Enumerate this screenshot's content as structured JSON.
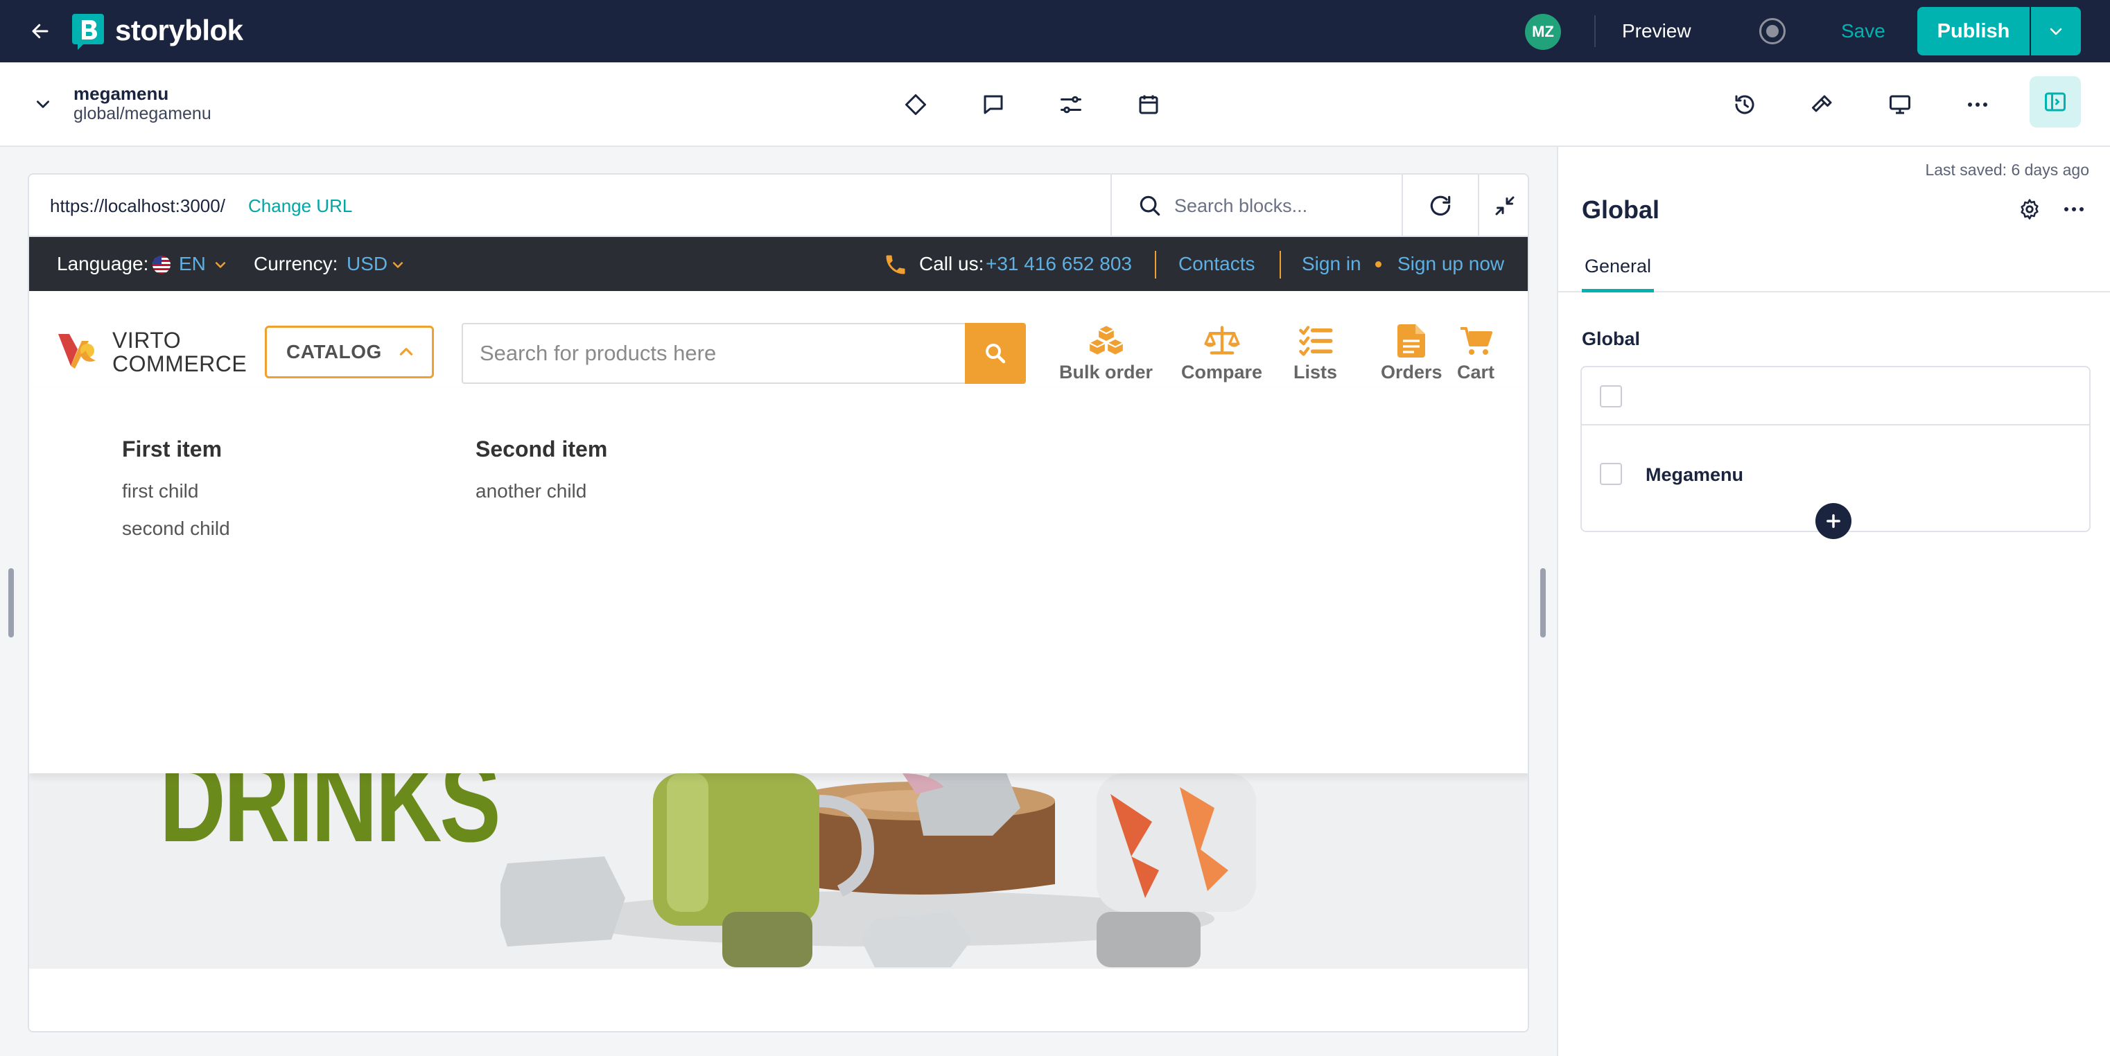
{
  "app": {
    "brand": "storyblok",
    "brand_color": "#00b3b0"
  },
  "topbar": {
    "avatar_initials": "MZ",
    "preview_label": "Preview",
    "save_label": "Save",
    "publish_label": "Publish"
  },
  "story": {
    "name": "megamenu",
    "path": "global/megamenu"
  },
  "preview": {
    "url": "https://localhost:3000/",
    "change_url_label": "Change URL",
    "block_search_placeholder": "Search blocks..."
  },
  "site": {
    "language_label": "Language:",
    "language_value": "EN",
    "currency_label": "Currency:",
    "currency_value": "USD",
    "call_label": "Call us:",
    "phone": "+31 416 652 803",
    "contacts": "Contacts",
    "sign_in": "Sign in",
    "sign_up": "Sign up now",
    "logo_line1": "VIRTO",
    "logo_line2": "COMMERCE",
    "catalog_label": "CATALOG",
    "search_placeholder": "Search for products here",
    "header_items": [
      "Bulk order",
      "Compare",
      "Lists",
      "Orders",
      "Cart"
    ],
    "accent_color": "#f0a030",
    "megamenu": [
      {
        "title": "First item",
        "children": [
          "first child",
          "second child"
        ]
      },
      {
        "title": "Second item",
        "children": [
          "another child"
        ]
      }
    ],
    "banner_word": "DRINKS"
  },
  "panel": {
    "last_saved": "Last saved: 6 days ago",
    "title": "Global",
    "tabs": [
      "General"
    ],
    "field_label": "Global",
    "blocks": [
      "Megamenu"
    ]
  }
}
